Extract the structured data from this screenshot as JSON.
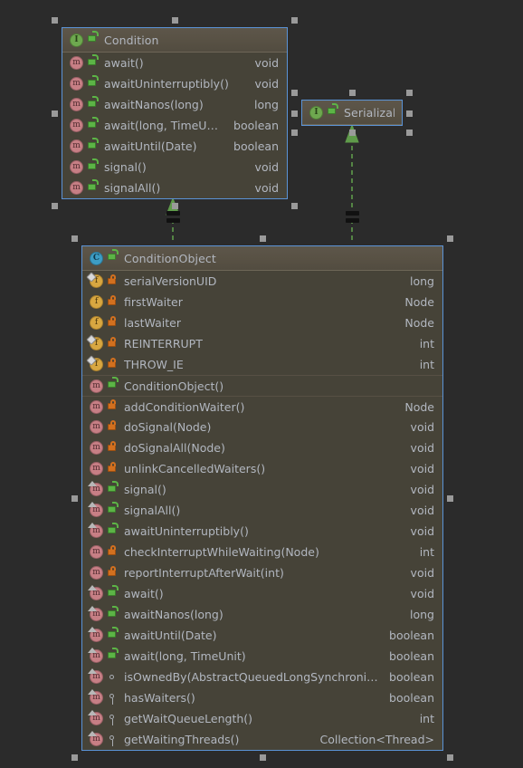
{
  "canvas": {
    "background_color": "#2b2b2b",
    "node_border_color": "#5b93d6",
    "header_color": "#575143",
    "body_color": "#464338",
    "text_color": "#b2b7c0",
    "relation_color": "#5f9b4a"
  },
  "nodes": [
    {
      "id": "condition",
      "name": "Condition",
      "kind_icon": "interface-icon",
      "visibility_icon": "public-unlock-icon",
      "selected": true,
      "members": [
        {
          "name": "await()",
          "type": "void",
          "kind_icon": "method-icon",
          "visibility_icon": "public-unlock-icon",
          "static": false,
          "override": false,
          "separator": false
        },
        {
          "name": "awaitUninterruptibly()",
          "type": "void",
          "kind_icon": "method-icon",
          "visibility_icon": "public-unlock-icon",
          "static": false,
          "override": false,
          "separator": false
        },
        {
          "name": "awaitNanos(long)",
          "type": "long",
          "kind_icon": "method-icon",
          "visibility_icon": "public-unlock-icon",
          "static": false,
          "override": false,
          "separator": false
        },
        {
          "name": "await(long, TimeUnit)",
          "type": "boolean",
          "kind_icon": "method-icon",
          "visibility_icon": "public-unlock-icon",
          "static": false,
          "override": false,
          "separator": false
        },
        {
          "name": "awaitUntil(Date)",
          "type": "boolean",
          "kind_icon": "method-icon",
          "visibility_icon": "public-unlock-icon",
          "static": false,
          "override": false,
          "separator": false
        },
        {
          "name": "signal()",
          "type": "void",
          "kind_icon": "method-icon",
          "visibility_icon": "public-unlock-icon",
          "static": false,
          "override": false,
          "separator": false
        },
        {
          "name": "signalAll()",
          "type": "void",
          "kind_icon": "method-icon",
          "visibility_icon": "public-unlock-icon",
          "static": false,
          "override": false,
          "separator": false
        }
      ]
    },
    {
      "id": "serializable",
      "name": "Serializable",
      "kind_icon": "interface-icon",
      "visibility_icon": "public-unlock-icon",
      "selected": true,
      "members": []
    },
    {
      "id": "conditionobject",
      "name": "ConditionObject",
      "kind_icon": "class-icon",
      "visibility_icon": "public-unlock-icon",
      "selected": true,
      "members": [
        {
          "name": "serialVersionUID",
          "type": "long",
          "kind_icon": "field-icon",
          "visibility_icon": "private-lock-icon",
          "static": true,
          "override": false,
          "separator": false
        },
        {
          "name": "firstWaiter",
          "type": "Node",
          "kind_icon": "field-icon",
          "visibility_icon": "private-lock-icon",
          "static": false,
          "override": false,
          "separator": false
        },
        {
          "name": "lastWaiter",
          "type": "Node",
          "kind_icon": "field-icon",
          "visibility_icon": "private-lock-icon",
          "static": false,
          "override": false,
          "separator": false
        },
        {
          "name": "REINTERRUPT",
          "type": "int",
          "kind_icon": "field-icon",
          "visibility_icon": "private-lock-icon",
          "static": true,
          "override": false,
          "separator": false
        },
        {
          "name": "THROW_IE",
          "type": "int",
          "kind_icon": "field-icon",
          "visibility_icon": "private-lock-icon",
          "static": true,
          "override": false,
          "separator": false
        },
        {
          "name": "ConditionObject()",
          "type": "",
          "kind_icon": "method-icon",
          "visibility_icon": "public-unlock-icon",
          "static": false,
          "override": false,
          "separator": true
        },
        {
          "name": "addConditionWaiter()",
          "type": "Node",
          "kind_icon": "method-icon",
          "visibility_icon": "private-lock-icon",
          "static": false,
          "override": false,
          "separator": true
        },
        {
          "name": "doSignal(Node)",
          "type": "void",
          "kind_icon": "method-icon",
          "visibility_icon": "private-lock-icon",
          "static": false,
          "override": false,
          "separator": false
        },
        {
          "name": "doSignalAll(Node)",
          "type": "void",
          "kind_icon": "method-icon",
          "visibility_icon": "private-lock-icon",
          "static": false,
          "override": false,
          "separator": false
        },
        {
          "name": "unlinkCancelledWaiters()",
          "type": "void",
          "kind_icon": "method-icon",
          "visibility_icon": "private-lock-icon",
          "static": false,
          "override": false,
          "separator": false
        },
        {
          "name": "signal()",
          "type": "void",
          "kind_icon": "method-icon",
          "visibility_icon": "public-unlock-icon",
          "static": false,
          "override": true,
          "separator": false
        },
        {
          "name": "signalAll()",
          "type": "void",
          "kind_icon": "method-icon",
          "visibility_icon": "public-unlock-icon",
          "static": false,
          "override": true,
          "separator": false
        },
        {
          "name": "awaitUninterruptibly()",
          "type": "void",
          "kind_icon": "method-icon",
          "visibility_icon": "public-unlock-icon",
          "static": false,
          "override": true,
          "separator": false
        },
        {
          "name": "checkInterruptWhileWaiting(Node)",
          "type": "int",
          "kind_icon": "method-icon",
          "visibility_icon": "private-lock-icon",
          "static": false,
          "override": false,
          "separator": false
        },
        {
          "name": "reportInterruptAfterWait(int)",
          "type": "void",
          "kind_icon": "method-icon",
          "visibility_icon": "private-lock-icon",
          "static": false,
          "override": false,
          "separator": false
        },
        {
          "name": "await()",
          "type": "void",
          "kind_icon": "method-icon",
          "visibility_icon": "public-unlock-icon",
          "static": false,
          "override": true,
          "separator": false
        },
        {
          "name": "awaitNanos(long)",
          "type": "long",
          "kind_icon": "method-icon",
          "visibility_icon": "public-unlock-icon",
          "static": false,
          "override": true,
          "separator": false
        },
        {
          "name": "awaitUntil(Date)",
          "type": "boolean",
          "kind_icon": "method-icon",
          "visibility_icon": "public-unlock-icon",
          "static": false,
          "override": true,
          "separator": false
        },
        {
          "name": "await(long, TimeUnit)",
          "type": "boolean",
          "kind_icon": "method-icon",
          "visibility_icon": "public-unlock-icon",
          "static": false,
          "override": true,
          "separator": false
        },
        {
          "name": "isOwnedBy(AbstractQueuedLongSynchronizer)",
          "type": "boolean",
          "kind_icon": "method-icon",
          "visibility_icon": "package-circle-icon",
          "static": false,
          "override": true,
          "separator": false
        },
        {
          "name": "hasWaiters()",
          "type": "boolean",
          "kind_icon": "method-icon",
          "visibility_icon": "protected-key-icon",
          "static": false,
          "override": true,
          "separator": false
        },
        {
          "name": "getWaitQueueLength()",
          "type": "int",
          "kind_icon": "method-icon",
          "visibility_icon": "protected-key-icon",
          "static": false,
          "override": true,
          "separator": false
        },
        {
          "name": "getWaitingThreads()",
          "type": "Collection<Thread>",
          "kind_icon": "method-icon",
          "visibility_icon": "protected-key-icon",
          "static": false,
          "override": true,
          "separator": false
        }
      ]
    }
  ],
  "relations": [
    {
      "id": "rel-implements-condition",
      "from": "conditionobject",
      "to": "condition",
      "style": "dashed",
      "arrow": "hollow-triangle",
      "label": "="
    },
    {
      "id": "rel-implements-serializable",
      "from": "conditionobject",
      "to": "serializable",
      "style": "dashed",
      "arrow": "hollow-triangle",
      "label": "="
    }
  ]
}
